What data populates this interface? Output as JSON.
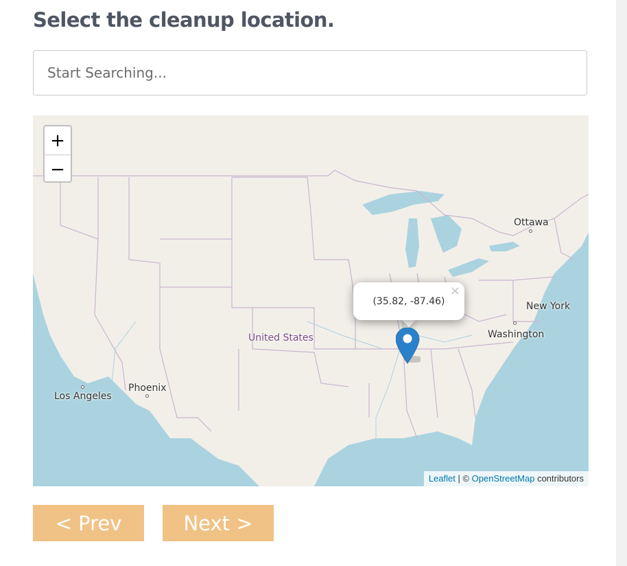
{
  "page": {
    "title": "Select the cleanup location."
  },
  "search": {
    "placeholder": "Start Searching...",
    "value": ""
  },
  "map": {
    "zoom_in_label": "+",
    "zoom_out_label": "−",
    "labels": {
      "ottawa": "Ottawa",
      "new_york": "New York",
      "washington": "Washington",
      "united_states": "United States",
      "phoenix": "Phoenix",
      "los_angeles": "Los Angeles"
    },
    "popup": {
      "text": "(35.82, -87.46)",
      "close": "×"
    },
    "marker_color": "#2a81cb",
    "attribution": {
      "leaflet": "Leaflet",
      "separator": " | © ",
      "osm": "OpenStreetMap",
      "suffix": " contributors"
    },
    "colors": {
      "water": "#aad3df",
      "land": "#f2efe9",
      "borders": "#c9b5cf"
    }
  },
  "navigation": {
    "prev_label": "< Prev",
    "next_label": "Next >",
    "button_color": "#f0c285"
  }
}
